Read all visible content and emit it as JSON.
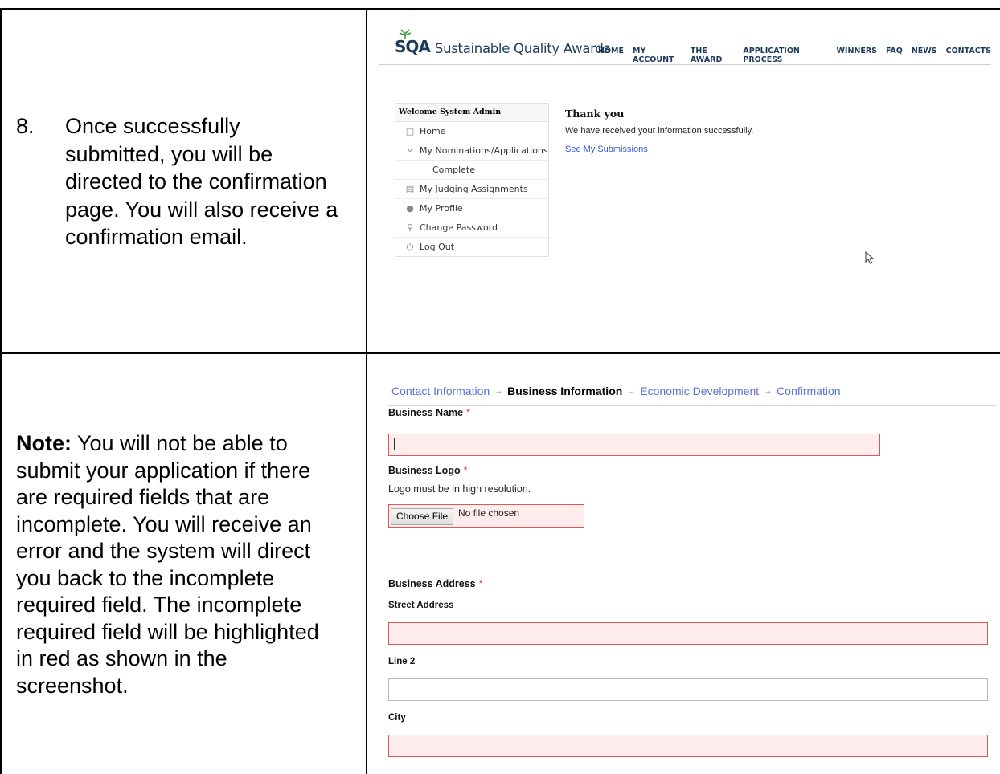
{
  "step8": {
    "number": "8.",
    "lines": [
      "Once successfully",
      "submitted, you will be",
      "directed to the confirmation",
      "page. You will also receive a",
      "confirmation email."
    ]
  },
  "note": {
    "label": "Note:",
    "first_line": " You will not be able to",
    "lines": [
      "submit your application if there",
      "are required fields that are",
      "incomplete. You will receive an",
      "error and the system will direct",
      "you back to the incomplete",
      "required field. The incomplete",
      "required field will be highlighted",
      "in red as shown in the",
      "screenshot."
    ]
  },
  "site": {
    "logo_mark": "SQA",
    "logo_text": "Sustainable Quality Awards",
    "nav": [
      "HOME",
      "MY ACCOUNT",
      "THE AWARD",
      "APPLICATION PROCESS",
      "WINNERS",
      "FAQ",
      "NEWS",
      "CONTACTS"
    ]
  },
  "sidebar": {
    "welcome": "Welcome System Admin",
    "items": [
      {
        "label": "Home",
        "icon": "home-icon"
      },
      {
        "label": "My Nominations/Applications",
        "icon": "nominations-icon"
      },
      {
        "label": "Complete",
        "icon": ""
      },
      {
        "label": "My Judging Assignments",
        "icon": "clipboard-icon"
      },
      {
        "label": "My Profile",
        "icon": "user-icon"
      },
      {
        "label": "Change Password",
        "icon": "key-icon"
      },
      {
        "label": "Log Out",
        "icon": "power-icon"
      }
    ]
  },
  "confirmation": {
    "title": "Thank you",
    "message": "We have received your information successfully.",
    "link": "See My Submissions"
  },
  "form": {
    "breadcrumb": [
      {
        "label": "Contact Information",
        "current": false
      },
      {
        "label": "Business Information",
        "current": true
      },
      {
        "label": "Economic Development",
        "current": false
      },
      {
        "label": "Confirmation",
        "current": false
      }
    ],
    "required_mark": "*",
    "business_name_label": "Business Name",
    "business_logo_label": "Business Logo",
    "logo_hint": "Logo must be in high resolution.",
    "choose_file": "Choose File",
    "no_file": "No file chosen",
    "business_address_label": "Business Address",
    "street_label": "Street Address",
    "line2_label": "Line 2",
    "city_label": "City"
  },
  "colors": {
    "error_border": "#e05757",
    "error_fill": "#ffecec",
    "link": "#5a73d6",
    "brand": "#1e3a5c"
  }
}
